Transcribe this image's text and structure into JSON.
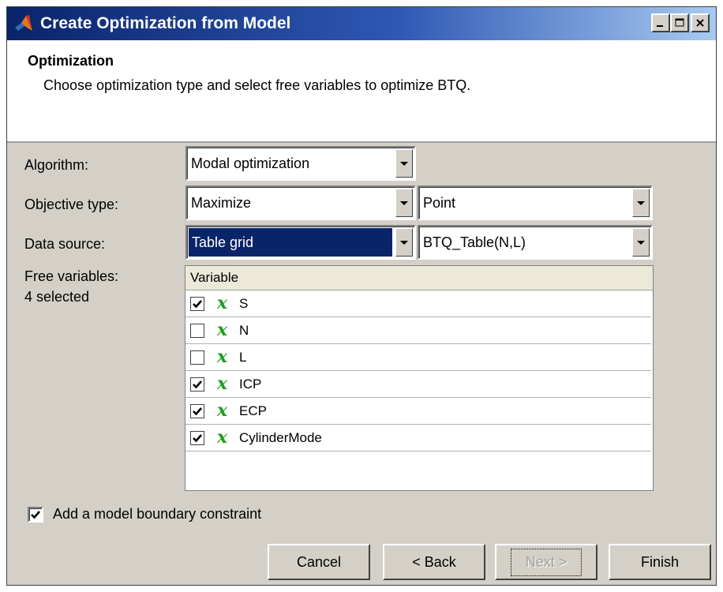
{
  "window": {
    "title": "Create Optimization from Model",
    "controls": [
      "minimize",
      "maximize",
      "close"
    ]
  },
  "header": {
    "title": "Optimization",
    "description": "Choose optimization type and select free variables to optimize BTQ."
  },
  "form": {
    "algorithm": {
      "label": "Algorithm:",
      "value": "Modal optimization"
    },
    "objective_type": {
      "label": "Objective type:",
      "value": "Maximize",
      "secondary_value": "Point"
    },
    "data_source": {
      "label": "Data source:",
      "value": "Table grid",
      "secondary_value": "BTQ_Table(N,L)"
    },
    "free_variables": {
      "label": "Free variables:",
      "count_text": "4 selected"
    }
  },
  "variables_table": {
    "header": "Variable",
    "rows": [
      {
        "name": "S",
        "checked": true,
        "icon": "x"
      },
      {
        "name": "N",
        "checked": false,
        "icon": "x"
      },
      {
        "name": "L",
        "checked": false,
        "icon": "x"
      },
      {
        "name": "ICP",
        "checked": true,
        "icon": "x"
      },
      {
        "name": "ECP",
        "checked": true,
        "icon": "x"
      },
      {
        "name": "CylinderMode",
        "checked": true,
        "icon": "x"
      }
    ]
  },
  "boundary_constraint": {
    "label": "Add a model boundary constraint",
    "checked": true
  },
  "buttons": {
    "cancel": "Cancel",
    "back": "< Back",
    "next": "Next >",
    "finish": "Finish"
  },
  "colors": {
    "title_bar": "#0a246a",
    "selection": "#0a246a",
    "variable_icon": "#1e9e1e",
    "dialog_bg": "#d4d0c8"
  }
}
